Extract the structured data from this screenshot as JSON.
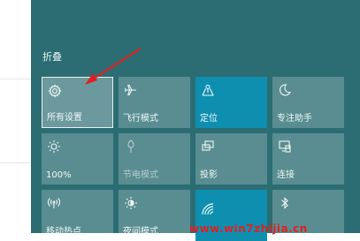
{
  "action_center": {
    "collapse_label": "折叠",
    "tiles": [
      {
        "label": "所有设置",
        "icon": "gear-icon",
        "state": "hovered"
      },
      {
        "label": "飞行模式",
        "icon": "airplane-icon",
        "state": "normal"
      },
      {
        "label": "定位",
        "icon": "location-icon",
        "state": "active"
      },
      {
        "label": "专注助手",
        "icon": "moon-icon",
        "state": "normal"
      },
      {
        "label": "100%",
        "icon": "brightness-icon",
        "state": "normal"
      },
      {
        "label": "节电模式",
        "icon": "battery-saver-icon",
        "state": "disabled"
      },
      {
        "label": "投影",
        "icon": "project-icon",
        "state": "normal"
      },
      {
        "label": "连接",
        "icon": "connect-icon",
        "state": "normal"
      },
      {
        "label": "移动热点",
        "icon": "hotspot-icon",
        "state": "normal"
      },
      {
        "label": "夜间模式",
        "icon": "night-light-icon",
        "state": "normal"
      },
      {
        "label": "",
        "icon": "wifi-icon",
        "state": "active"
      },
      {
        "label": "",
        "icon": "bluetooth-icon",
        "state": "normal"
      }
    ]
  },
  "watermark": "www.win7zhijia.cn",
  "colors": {
    "panel": "#2b6d73",
    "active_tile": "#0e8fb0",
    "annotation_arrow": "#e02020"
  }
}
